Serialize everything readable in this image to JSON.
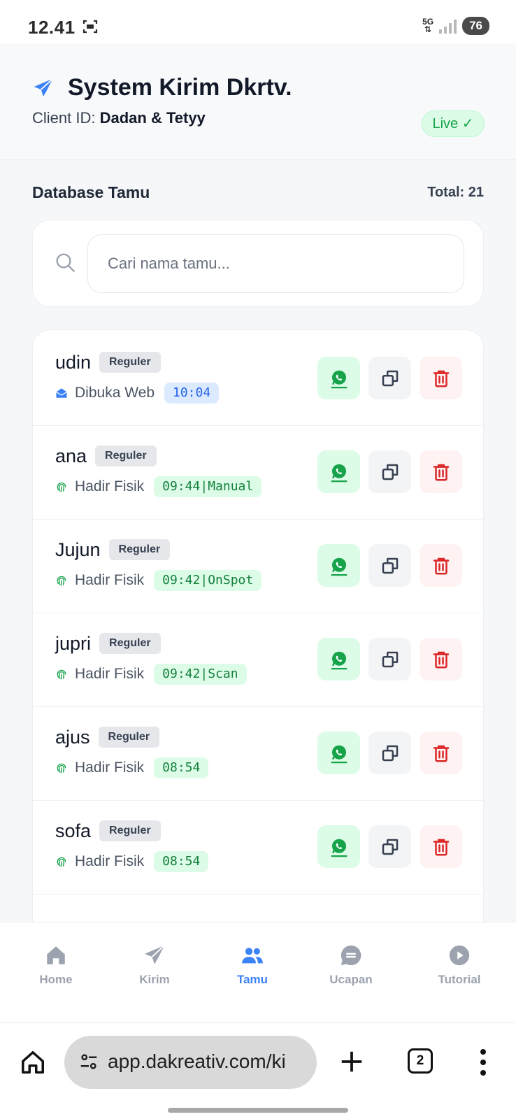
{
  "status_bar": {
    "time": "12.41",
    "network": "5G",
    "battery": "76"
  },
  "header": {
    "title": "System Kirim Dkrtv.",
    "client_label": "Client ID:",
    "client_name": "Dadan & Tetyy",
    "live_badge": "Live ✓"
  },
  "section": {
    "title": "Database Tamu",
    "total": "Total: 21"
  },
  "search": {
    "placeholder": "Cari nama tamu...",
    "value": ""
  },
  "guests": [
    {
      "name": "udin",
      "category": "Reguler",
      "status": "Dibuka Web",
      "status_icon": "envelope-open-icon",
      "time": "10:04",
      "time_style": "blue"
    },
    {
      "name": "ana",
      "category": "Reguler",
      "status": "Hadir Fisik",
      "status_icon": "fingerprint-icon",
      "time": "09:44|Manual",
      "time_style": "green"
    },
    {
      "name": "Jujun",
      "category": "Reguler",
      "status": "Hadir Fisik",
      "status_icon": "fingerprint-icon",
      "time": "09:42|OnSpot",
      "time_style": "green"
    },
    {
      "name": "jupri",
      "category": "Reguler",
      "status": "Hadir Fisik",
      "status_icon": "fingerprint-icon",
      "time": "09:42|Scan",
      "time_style": "green"
    },
    {
      "name": "ajus",
      "category": "Reguler",
      "status": "Hadir Fisik",
      "status_icon": "fingerprint-icon",
      "time": "08:54",
      "time_style": "green"
    },
    {
      "name": "sofa",
      "category": "Reguler",
      "status": "Hadir Fisik",
      "status_icon": "fingerprint-icon",
      "time": "08:54",
      "time_style": "green"
    }
  ],
  "bottom_nav": [
    {
      "label": "Home",
      "icon": "home-icon",
      "active": false
    },
    {
      "label": "Kirim",
      "icon": "paper-plane-icon",
      "active": false
    },
    {
      "label": "Tamu",
      "icon": "users-icon",
      "active": true
    },
    {
      "label": "Ucapan",
      "icon": "chat-bubble-icon",
      "active": false
    },
    {
      "label": "Tutorial",
      "icon": "play-circle-icon",
      "active": false
    }
  ],
  "browser": {
    "url": "app.dakreativ.com/ki",
    "tab_count": "2"
  },
  "colors": {
    "accent": "#3b82f6",
    "success": "#16a34a",
    "danger": "#dc2626"
  }
}
